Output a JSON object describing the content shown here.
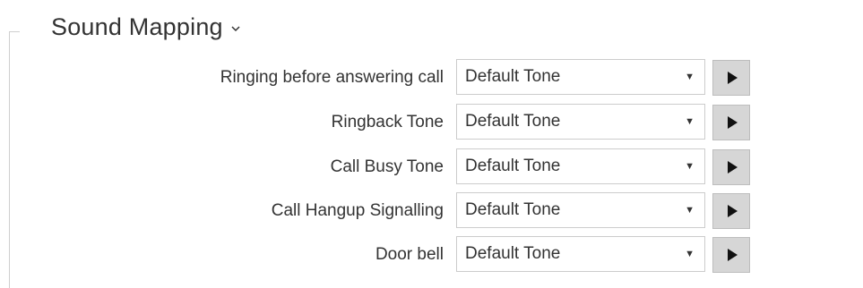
{
  "section": {
    "title": "Sound Mapping",
    "chevron_icon": "chevron-down-icon"
  },
  "rows": [
    {
      "label": "Ringing before answering call",
      "value": "Default Tone",
      "arrow": "▼",
      "play_icon": "play-icon"
    },
    {
      "label": "Ringback Tone",
      "value": "Default Tone",
      "arrow": "▼",
      "play_icon": "play-icon"
    },
    {
      "label": "Call Busy Tone",
      "value": "Default Tone",
      "arrow": "▼",
      "play_icon": "play-icon"
    },
    {
      "label": "Call Hangup Signalling",
      "value": "Default Tone",
      "arrow": "▼",
      "play_icon": "play-icon"
    },
    {
      "label": "Door bell",
      "value": "Default Tone",
      "arrow": "▼",
      "play_icon": "play-icon"
    }
  ]
}
